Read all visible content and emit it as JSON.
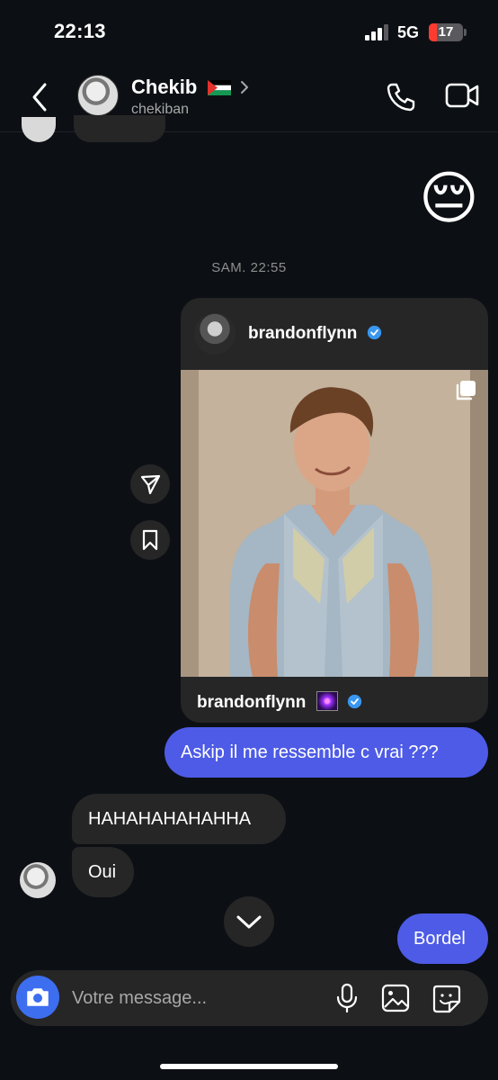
{
  "status_bar": {
    "time": "22:13",
    "network": "5G",
    "battery": "17"
  },
  "header": {
    "name": "Chekib",
    "username": "chekiban"
  },
  "messages": {
    "emoji": "😔",
    "timestamp": "SAM. 22:55",
    "shared_post": {
      "author": "brandonflynn",
      "caption_author": "brandonflynn",
      "caption_emoji": "sparkle-icon"
    },
    "outgoing_1": "Askip il me ressemble c vrai ???",
    "incoming_1": "HAHAHAHAHAHHA",
    "incoming_2": "Oui",
    "outgoing_2": "Bordel"
  },
  "composer": {
    "placeholder": "Votre message..."
  },
  "colors": {
    "background": "#0c1014",
    "outgoing_bubble": "#4d5be6",
    "incoming_bubble": "#262626",
    "camera_button": "#3d6ef0",
    "verified": "#3897f0"
  }
}
